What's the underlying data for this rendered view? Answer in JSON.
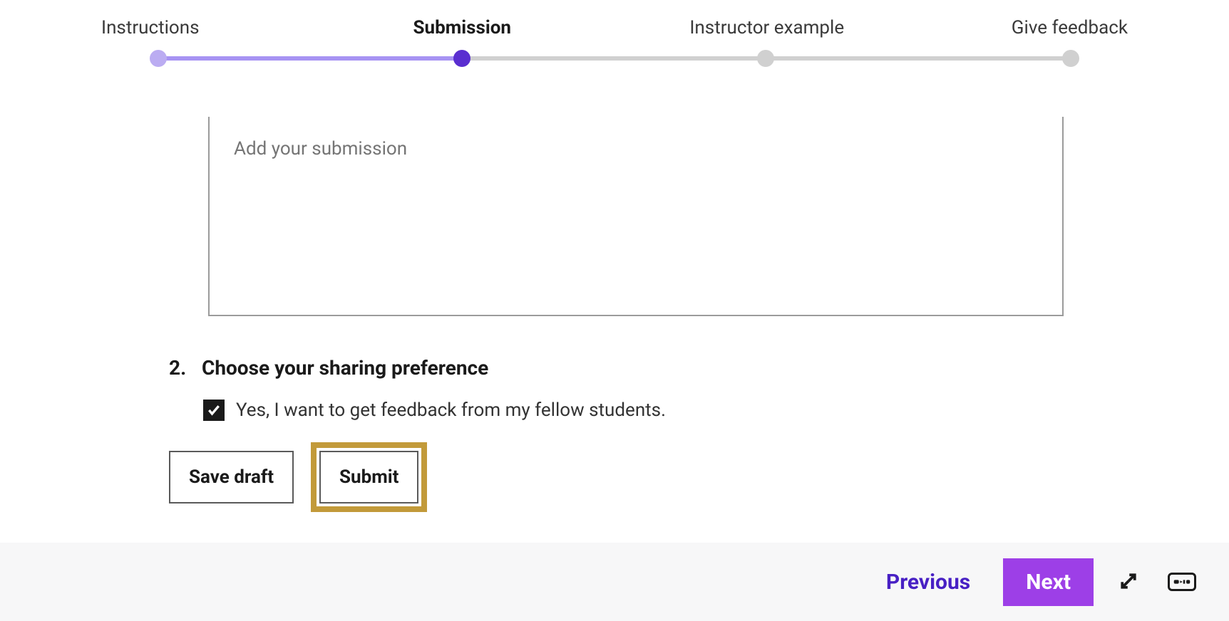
{
  "stepper": {
    "steps": [
      {
        "label": "Instructions"
      },
      {
        "label": "Submission"
      },
      {
        "label": "Instructor example"
      },
      {
        "label": "Give feedback"
      }
    ],
    "active_index": 1
  },
  "submission": {
    "placeholder": "Add your submission"
  },
  "section2": {
    "number": "2.",
    "title": "Choose your sharing preference",
    "checkbox_checked": true,
    "checkbox_label": "Yes, I want to get feedback from my fellow students."
  },
  "buttons": {
    "save_draft": "Save draft",
    "submit": "Submit"
  },
  "footer": {
    "previous": "Previous",
    "next": "Next"
  },
  "icons": {
    "expand": "expand-icon",
    "cc": "captions-icon"
  }
}
